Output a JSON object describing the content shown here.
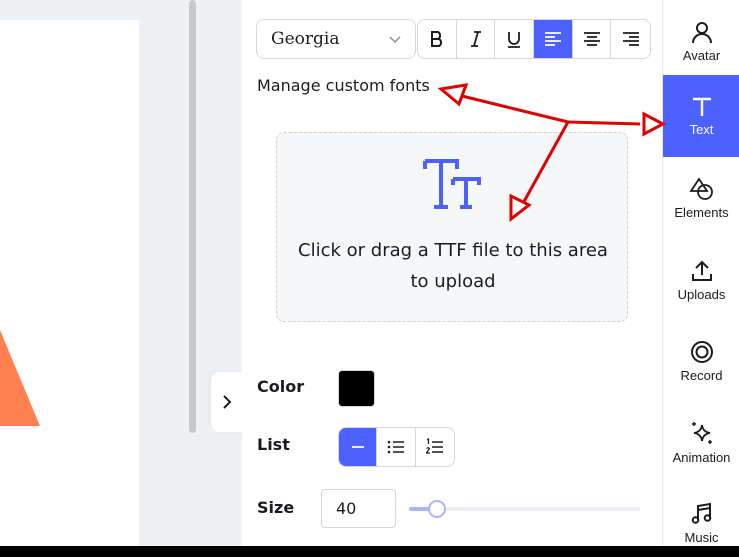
{
  "font_picker": {
    "value": "Georgia"
  },
  "style_buttons": [
    {
      "name": "bold",
      "icon": "bold-icon"
    },
    {
      "name": "italic",
      "icon": "italic-icon"
    },
    {
      "name": "underline",
      "icon": "underline-icon"
    },
    {
      "name": "align-left",
      "icon": "align-left-icon",
      "active": true
    },
    {
      "name": "align-center",
      "icon": "align-center-icon"
    },
    {
      "name": "align-right",
      "icon": "align-right-icon"
    }
  ],
  "manage_fonts": {
    "label": "Manage custom fonts"
  },
  "upload": {
    "icon": "text-tt-icon",
    "text": "Click or drag a TTF file to this area to upload"
  },
  "color": {
    "label": "Color",
    "value": "#000000"
  },
  "list": {
    "label": "List",
    "options": [
      "none",
      "bulleted",
      "numbered"
    ],
    "active": "none"
  },
  "size": {
    "label": "Size",
    "value": "40",
    "slider_fraction": 0.12
  },
  "sidebar": {
    "items": [
      {
        "label": "Avatar",
        "icon": "person-icon"
      },
      {
        "label": "Text",
        "icon": "text-icon",
        "active": true
      },
      {
        "label": "Elements",
        "icon": "shapes-icon"
      },
      {
        "label": "Uploads",
        "icon": "upload-icon"
      },
      {
        "label": "Record",
        "icon": "record-icon"
      },
      {
        "label": "Animation",
        "icon": "sparkle-icon"
      },
      {
        "label": "Music",
        "icon": "music-note-icon"
      }
    ]
  },
  "colors": {
    "accent": "#4d61ff",
    "shape": "#ff8151",
    "annotation": "#e00000"
  }
}
